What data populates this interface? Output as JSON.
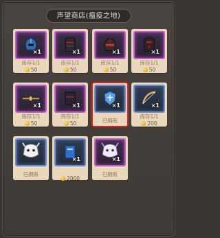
{
  "shop": {
    "title": "声望商店(瘟疫之地)",
    "items": [
      {
        "rarity": "purple",
        "icon": "blue-helmet-icon",
        "qty": "×1",
        "stock": "库存1/1",
        "price": "50",
        "owned": false,
        "selected": false
      },
      {
        "rarity": "purple",
        "icon": "chest-armor-icon",
        "qty": "×1",
        "stock": "库存1/1",
        "price": "50",
        "owned": false,
        "selected": false
      },
      {
        "rarity": "purple",
        "icon": "red-helmet-icon",
        "qty": "×1",
        "stock": "库存1/1",
        "price": "50",
        "owned": false,
        "selected": false
      },
      {
        "rarity": "purple",
        "icon": "dark-chest-icon",
        "qty": "×1",
        "stock": "库存1/1",
        "price": "50",
        "owned": false,
        "selected": false
      },
      {
        "rarity": "purple",
        "icon": "wand-icon",
        "qty": "×1",
        "stock": "库存1/1",
        "price": "50",
        "owned": false,
        "selected": false
      },
      {
        "rarity": "purple",
        "icon": "robe-icon",
        "qty": "×1",
        "stock": "库存1/1",
        "price": "50",
        "owned": false,
        "selected": false
      },
      {
        "rarity": "blue",
        "icon": "blue-shield-icon",
        "qty": "×1",
        "stock": "",
        "price": "",
        "owned": true,
        "owned_label": "已拥有",
        "selected": true
      },
      {
        "rarity": "blue",
        "icon": "bow-icon",
        "qty": "×1",
        "stock": "库存1/1",
        "price": "200",
        "owned": false,
        "selected": false
      },
      {
        "rarity": "blue",
        "icon": "beast-mount-icon",
        "qty": "",
        "stock": "",
        "price": "",
        "owned": true,
        "owned_label": "已拥有",
        "selected": false
      },
      {
        "rarity": "blue",
        "icon": "blue-book-icon",
        "qty": "×1",
        "stock": "",
        "price": "2000",
        "owned": false,
        "selected": false
      },
      {
        "rarity": "purple",
        "icon": "purple-mount-icon",
        "qty": "×1",
        "stock": "",
        "price": "",
        "owned": true,
        "owned_label": "已拥有",
        "selected": false
      }
    ]
  },
  "colors": {
    "selected_border": "#e1231c",
    "purple_border": "#c25cd0",
    "blue_border": "#6a8ed6",
    "coin": "#e3a51b"
  }
}
